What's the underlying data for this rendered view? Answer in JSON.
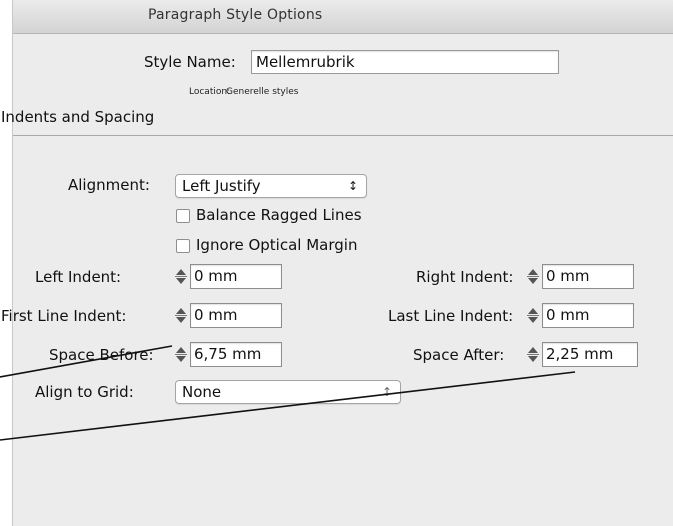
{
  "dialog": {
    "title": "Paragraph Style Options",
    "style_name_label": "Style Name:",
    "style_name_value": "Mellemrubrik",
    "location_label": "Location:",
    "location_value": "Generelle styles",
    "section_title": "Indents and Spacing"
  },
  "alignment": {
    "label": "Alignment:",
    "selected": "Left Justify",
    "arrows": "↕"
  },
  "options": [
    {
      "label": "Balance Ragged Lines",
      "checked": false
    },
    {
      "label": "Ignore Optical Margin",
      "checked": false
    }
  ],
  "fields": {
    "left_indent": {
      "label": "Left Indent:",
      "value": "0 mm"
    },
    "right_indent": {
      "label": "Right Indent:",
      "value": "0 mm"
    },
    "first_line_indent": {
      "label": "First Line Indent:",
      "value": "0 mm"
    },
    "last_line_indent": {
      "label": "Last Line Indent:",
      "value": "0 mm"
    },
    "space_before": {
      "label": "Space Before:",
      "value": "6,75 mm"
    },
    "space_after": {
      "label": "Space After:",
      "value": "2,25 mm"
    }
  },
  "grid": {
    "label": "Align to Grid:",
    "selected": "None",
    "arrows": "↕"
  }
}
